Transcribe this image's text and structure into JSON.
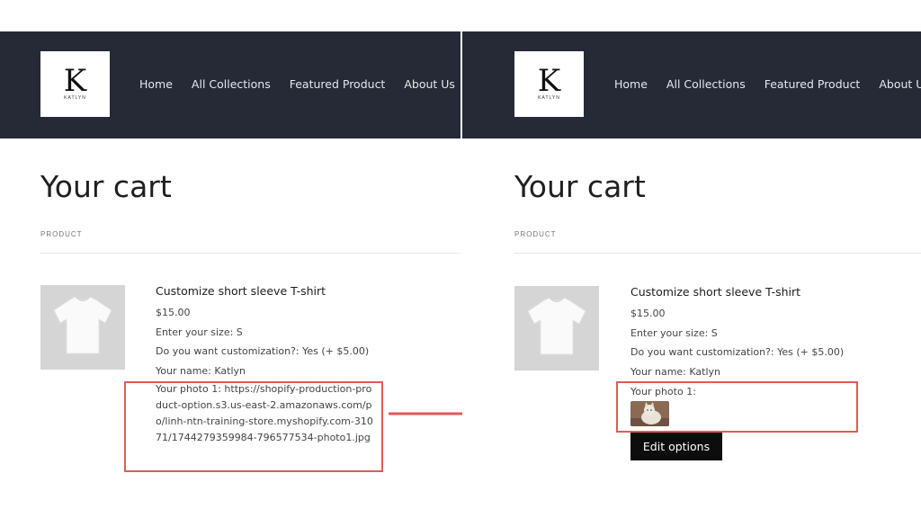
{
  "brand": {
    "logo_letter": "K",
    "logo_small_text": "KATLYN"
  },
  "nav": {
    "items": [
      "Home",
      "All Collections",
      "Featured Product",
      "About Us"
    ]
  },
  "cart": {
    "title": "Your cart",
    "column_label": "PRODUCT",
    "product_name": "Customize short sleeve T-shirt",
    "price": "$15.00",
    "size_line": "Enter your size: S",
    "custom_line": "Do you want customization?: Yes (+ $5.00)",
    "name_line": "Your name: Katlyn"
  },
  "left": {
    "photo_line": "Your photo 1: https://shopify-production-product-option.s3.us-east-2.amazonaws.com/po/linh-ntn-training-store.myshopify.com-31071/1744279359984-796577534-photo1.jpg"
  },
  "right": {
    "photo_label": "Your photo 1:",
    "edit_button": "Edit options"
  },
  "colors": {
    "header_bg": "#252a36",
    "highlight": "#e05a5a",
    "button_bg": "#0d0d0d"
  },
  "icons": {
    "product_image": "white-tshirt-icon",
    "photo_preview": "cat-photo-icon",
    "connector": "right-arrow-icon"
  }
}
